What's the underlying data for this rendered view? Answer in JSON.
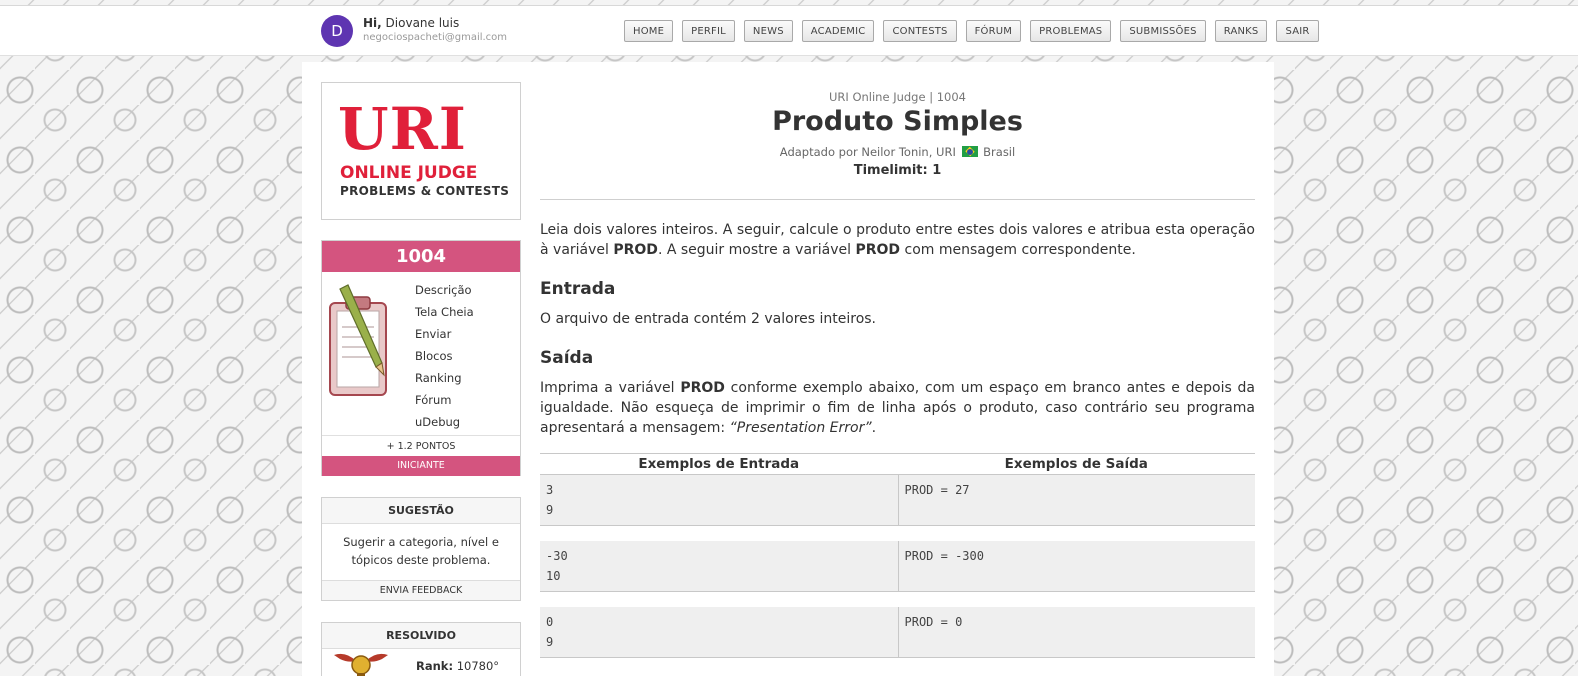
{
  "user": {
    "avatar_letter": "D",
    "greeting_prefix": "Hi,",
    "name": "Diovane luis",
    "email": "negociospacheti@gmail.com"
  },
  "nav": [
    "HOME",
    "PERFIL",
    "NEWS",
    "ACADEMIC",
    "CONTESTS",
    "FÓRUM",
    "PROBLEMAS",
    "SUBMISSÕES",
    "RANKS",
    "SAIR"
  ],
  "logo": {
    "main": "URI",
    "line1": "ONLINE JUDGE",
    "line2": "PROBLEMS & CONTESTS"
  },
  "problem_box": {
    "number": "1004",
    "menu": [
      "Descrição",
      "Tela Cheia",
      "Enviar",
      "Blocos",
      "Ranking",
      "Fórum",
      "uDebug"
    ],
    "points": "+ 1.2 PONTOS",
    "level": "INICIANTE"
  },
  "suggestion": {
    "title": "SUGESTÃO",
    "text": "Sugerir a categoria, nível e tópicos deste problema.",
    "button": "ENVIA FEEDBACK"
  },
  "solved": {
    "title": "RESOLVIDO",
    "rank_label": "Rank:",
    "rank_value": "10780°"
  },
  "problem": {
    "crumb": "URI Online Judge | 1004",
    "title": "Produto Simples",
    "author_prefix": "Adaptado por Neilor Tonin, URI",
    "country": "Brasil",
    "timelimit": "Timelimit: 1",
    "desc_1": "Leia dois valores inteiros. A seguir, calcule o produto entre estes dois valores e atribua esta operação à variável ",
    "desc_var1": "PROD",
    "desc_2": ". A seguir mostre a variável ",
    "desc_var2": "PROD",
    "desc_3": " com mensagem correspondente.",
    "input_title": "Entrada",
    "input_text": "O arquivo de entrada contém 2 valores inteiros.",
    "output_title": "Saída",
    "out_1": "Imprima a variável ",
    "out_var": "PROD",
    "out_2": " conforme exemplo abaixo, com um espaço em branco antes e depois da igualdade. Não esqueça de imprimir o fim de linha após o produto, caso contrário seu programa apresentará a mensagem: ",
    "out_err": "“Presentation Error”",
    "out_3": "."
  },
  "examples": {
    "input_header": "Exemplos de Entrada",
    "output_header": "Exemplos de Saída",
    "rows": [
      {
        "input": "3\n9",
        "output": "PROD = 27"
      },
      {
        "input": "-30\n10",
        "output": "PROD = -300"
      },
      {
        "input": "0\n9",
        "output": "PROD = 0"
      }
    ]
  }
}
